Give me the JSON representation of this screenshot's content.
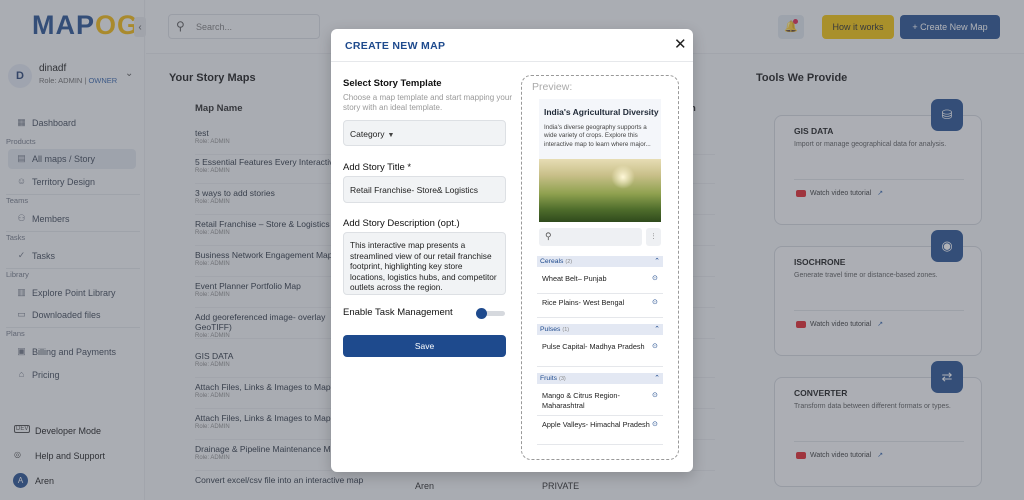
{
  "brand": {
    "logo_left": "MAP",
    "logo_right": "OG"
  },
  "user": {
    "initial": "D",
    "name": "dinadf",
    "role_prefix": "Role: ADMIN | ",
    "role_owner": "OWNER"
  },
  "sidebar": {
    "dashboard": "Dashboard",
    "sec_products": "Products",
    "all_maps": "All maps / Story",
    "territory": "Territory Design",
    "sec_teams": "Teams",
    "members": "Members",
    "sec_tasks": "Tasks",
    "tasks": "Tasks",
    "sec_library": "Library",
    "explore": "Explore Point Library",
    "downloaded": "Downloaded files",
    "sec_plans": "Plans",
    "billing": "Billing and Payments",
    "pricing": "Pricing",
    "dev_badge": "DEV",
    "dev_mode": "Developer Mode",
    "help": "Help and Support",
    "bottom_user_initial": "A",
    "bottom_user": "Aren"
  },
  "topbar": {
    "search_placeholder": "Search...",
    "how_it_works": "How it works",
    "create_new_map": "+ Create New Map"
  },
  "story_maps": {
    "title": "Your Story Maps",
    "col_map_name": "Map Name",
    "col_partial": "n",
    "rows": [
      {
        "name": "test",
        "role": "Role: ADMIN"
      },
      {
        "name": "5 Essential Features Every Interactive",
        "role": "Role: ADMIN"
      },
      {
        "name": "3 ways to add stories",
        "role": "Role: ADMIN"
      },
      {
        "name": "Retail Franchise – Store & Logistics",
        "role": "Role: ADMIN"
      },
      {
        "name": "Business Network Engagement Map",
        "role": "Role: ADMIN"
      },
      {
        "name": "Event Planner Portfolio Map",
        "role": "Role: ADMIN"
      },
      {
        "name": "Add georeferenced image- overlay GeoTIFF)",
        "role": "Role: ADMIN"
      },
      {
        "name": "GIS DATA",
        "role": "Role: ADMIN"
      },
      {
        "name": "Attach Files, Links & Images to Map",
        "role": "Role: ADMIN"
      },
      {
        "name": "Attach Files, Links & Images to Map",
        "role": "Role: ADMIN"
      },
      {
        "name": "Drainage & Pipeline Maintenance Map",
        "role": "Role: ADMIN"
      },
      {
        "name": "Convert excel/csv file into an interactive map",
        "role": ""
      }
    ],
    "last_row_owner": "Aren",
    "last_row_status": "PRIVATE"
  },
  "tools": {
    "title": "Tools We Provide",
    "cards": [
      {
        "title": "GIS DATA",
        "desc": "Import or manage geographical data for analysis.",
        "video": "Watch video tutorial"
      },
      {
        "title": "ISOCHRONE",
        "desc": "Generate travel time or distance-based zones.",
        "video": "Watch video tutorial"
      },
      {
        "title": "CONVERTER",
        "desc": "Transform data between different formats or types.",
        "video": "Watch video tutorial"
      }
    ]
  },
  "modal": {
    "title": "CREATE NEW MAP",
    "template_label": "Select Story Template",
    "template_hint": "Choose a map template and start mapping your story with an ideal template.",
    "category": "Category",
    "story_title_label": "Add Story Title *",
    "story_title_value": "Retail Franchise- Store& Logistics",
    "desc_label": "Add Story Description (opt.)",
    "desc_value": "This interactive map presents a streamlined view of our retail franchise footprint, highlighting key store locations, logistics hubs, and competitor outlets across the region.",
    "task_label": "Enable Task Management",
    "save": "Save"
  },
  "preview": {
    "label": "Preview:",
    "title": "India's Agricultural Diversity",
    "desc": "India's diverse geography supports a wide variety of crops. Explore this interactive map to learn where major...",
    "categories": [
      {
        "name": "Cereals",
        "count": "(2)",
        "items": [
          "Wheat Belt– Punjab",
          "Rice Plains- West Bengal"
        ]
      },
      {
        "name": "Pulses",
        "count": "(1)",
        "items": [
          "Pulse Capital- Madhya Pradesh"
        ]
      },
      {
        "name": "Fruits",
        "count": "(3)",
        "items": [
          "Mango & Citrus Region- Maharashtral",
          "Apple Valleys- Himachal Pradesh"
        ]
      }
    ]
  }
}
